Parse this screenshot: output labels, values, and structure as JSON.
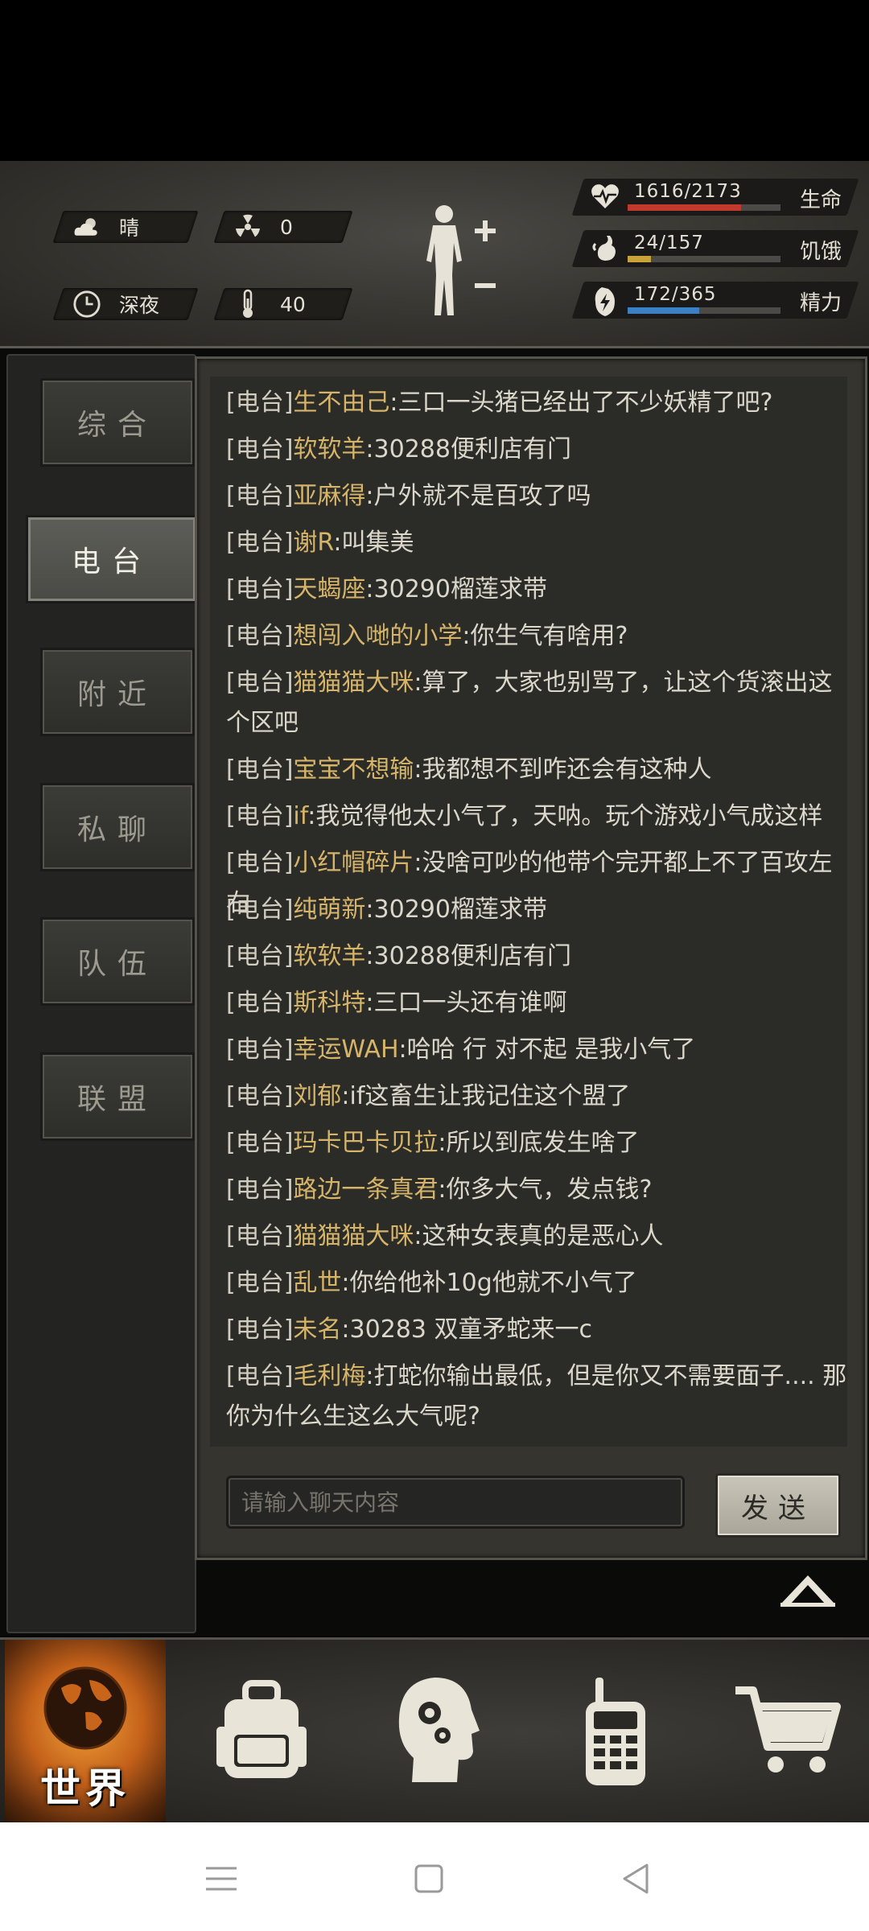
{
  "hud": {
    "weather": {
      "icon": "cloud-sun-icon",
      "label": "晴"
    },
    "radiation": {
      "icon": "radiation-icon",
      "value": "0"
    },
    "time": {
      "icon": "clock-icon",
      "label": "深夜"
    },
    "temperature": {
      "icon": "thermometer-icon",
      "value": "40"
    },
    "body_icon": "body-status-icon",
    "stats": [
      {
        "icon": "heart-pulse-icon",
        "value": "1616/2173",
        "label": "生命",
        "fraction": 0.744,
        "color": "#c0392b"
      },
      {
        "icon": "stomach-icon",
        "value": "24/157",
        "label": "饥饿",
        "fraction": 0.153,
        "color": "#c9a23a"
      },
      {
        "icon": "energy-icon",
        "value": "172/365",
        "label": "精力",
        "fraction": 0.471,
        "color": "#3b7fc4"
      }
    ]
  },
  "sidebar": {
    "tabs": [
      {
        "label": "综合",
        "active": false
      },
      {
        "label": "电台",
        "active": true
      },
      {
        "label": "附近",
        "active": false
      },
      {
        "label": "私聊",
        "active": false
      },
      {
        "label": "队伍",
        "active": false
      },
      {
        "label": "联盟",
        "active": false
      }
    ]
  },
  "chat": {
    "messages": [
      {
        "channel": "[电台]",
        "name": "生不由己",
        "text": ":三口一头猪已经出了不少妖精了吧?"
      },
      {
        "channel": "[电台]",
        "name": "软软羊",
        "text": ":30288便利店有门"
      },
      {
        "channel": "[电台]",
        "name": "亚麻得",
        "text": ":户外就不是百攻了吗"
      },
      {
        "channel": "[电台]",
        "name": "谢R",
        "text": ":叫集美"
      },
      {
        "channel": "[电台]",
        "name": "天蝎座",
        "text": ":30290榴莲求带"
      },
      {
        "channel": "[电台]",
        "name": "想闯入哋的小学",
        "text": ":你生气有啥用?"
      },
      {
        "channel": "[电台]",
        "name": "猫猫猫大咪",
        "text": ":算了，大家也别骂了，让这个货滚出这个区吧"
      },
      {
        "channel": "[电台]",
        "name": "宝宝不想输",
        "text": ":我都想不到咋还会有这种人"
      },
      {
        "channel": "[电台]",
        "name": "if",
        "text": ":我觉得他太小气了，天呐。玩个游戏小气成这样"
      },
      {
        "channel": "[电台]",
        "name": "小红帽碎片",
        "text": ":没啥可吵的他带个完开都上不了百攻左右"
      },
      {
        "channel": "[电台]",
        "name": "纯萌新",
        "text": ":30290榴莲求带"
      },
      {
        "channel": "[电台]",
        "name": "软软羊",
        "text": ":30288便利店有门"
      },
      {
        "channel": "[电台]",
        "name": "斯科特",
        "text": ":三口一头还有谁啊"
      },
      {
        "channel": "[电台]",
        "name": "幸运WAH",
        "text": ":哈哈 行 对不起 是我小气了"
      },
      {
        "channel": "[电台]",
        "name": "刘郁",
        "text": ":if这畜生让我记住这个盟了"
      },
      {
        "channel": "[电台]",
        "name": "玛卡巴卡贝拉",
        "text": ":所以到底发生啥了"
      },
      {
        "channel": "[电台]",
        "name": "路边一条真君",
        "text": ":你多大气，发点钱?"
      },
      {
        "channel": "[电台]",
        "name": "猫猫猫大咪",
        "text": ":这种女表真的是恶心人"
      },
      {
        "channel": "[电台]",
        "name": "乱世",
        "text": ":你给他补10g他就不小气了"
      },
      {
        "channel": "[电台]",
        "name": "未名",
        "text": ":30283 双童矛蛇来一c"
      },
      {
        "channel": "[电台]",
        "name": "毛利梅",
        "text": ":打蛇你输出最低，但是你又不需要面子.... 那你为什么生这么大气呢?"
      }
    ],
    "input_placeholder": "请输入聊天内容",
    "send_label": "发送"
  },
  "bottom_nav": {
    "world_label": "世界",
    "items": [
      "globe-icon",
      "backpack-icon",
      "brain-head-icon",
      "radio-transceiver-icon",
      "shopping-cart-icon"
    ]
  },
  "system_nav": [
    "menu-icon",
    "home-square-icon",
    "back-triangle-icon"
  ]
}
